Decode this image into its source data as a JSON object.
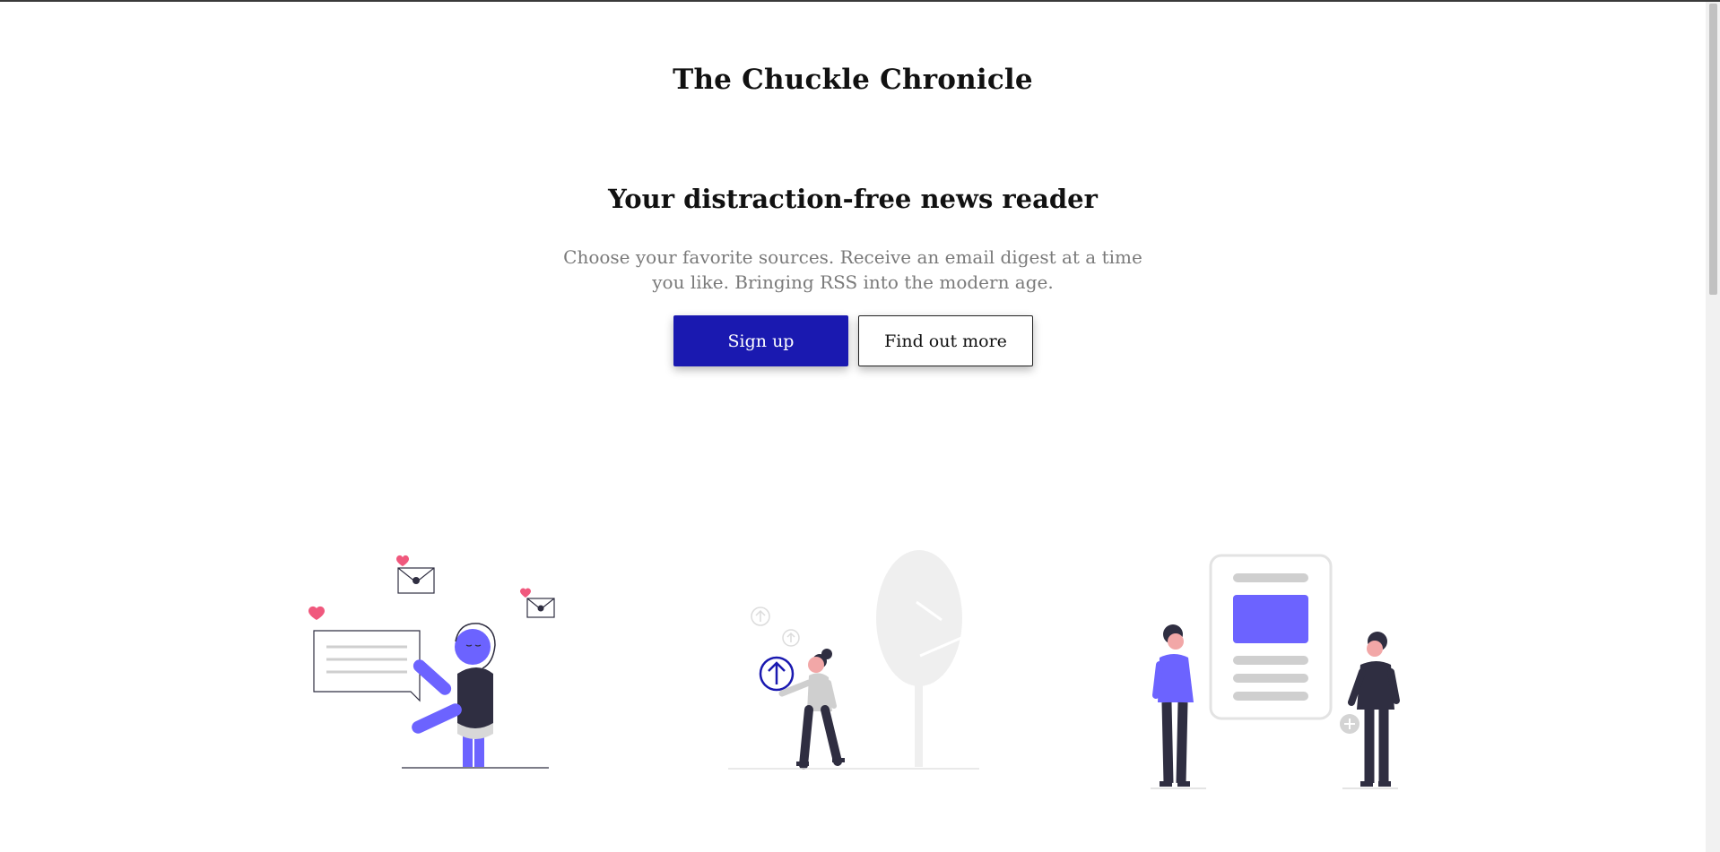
{
  "header": {
    "site_title": "The Chuckle Chronicle"
  },
  "hero": {
    "title": "Your distraction-free news reader",
    "subtitle": "Choose your favorite sources. Receive an email digest at a time you like. Bringing RSS into the modern age.",
    "signup_label": "Sign up",
    "more_label": "Find out more"
  },
  "colors": {
    "primary": "#1a19b0",
    "accent": "#6c63ff",
    "heart": "#f0587d",
    "dark": "#2f2e41",
    "muted": "#7a7a7a"
  },
  "illustrations": [
    {
      "name": "love-messages-illustration"
    },
    {
      "name": "upload-illustration"
    },
    {
      "name": "article-reading-illustration"
    }
  ]
}
